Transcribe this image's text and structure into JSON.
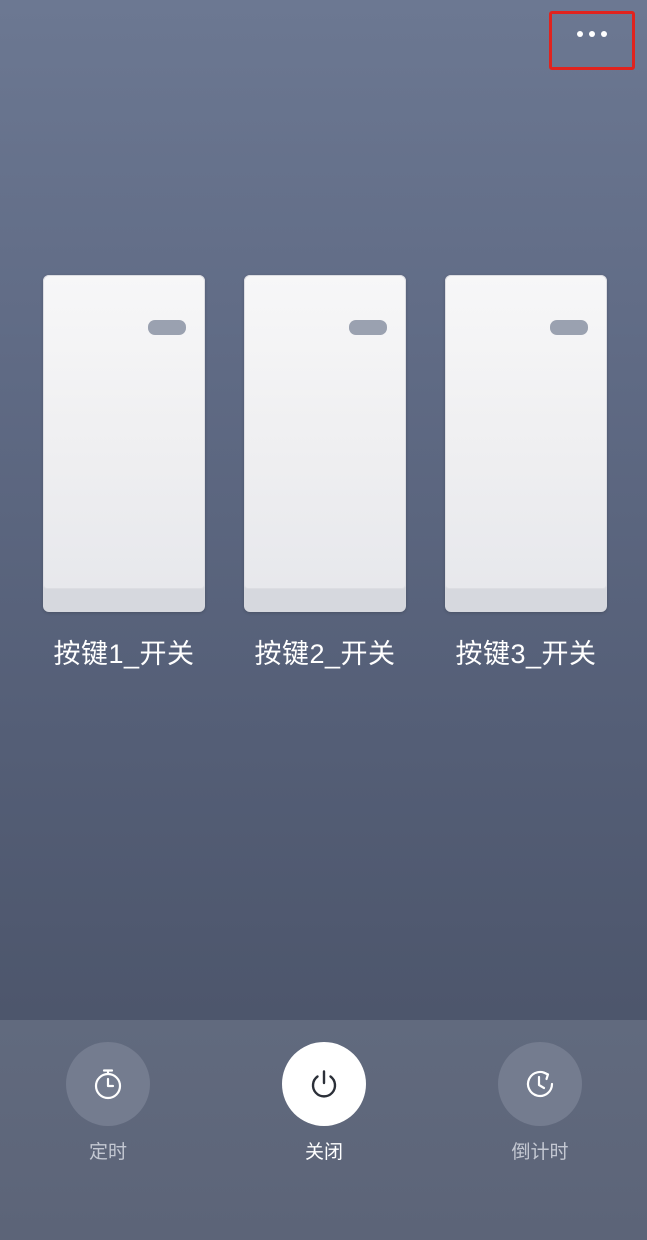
{
  "header": {
    "more_icon": "more-icon"
  },
  "switches": [
    {
      "label": "按键1_开关"
    },
    {
      "label": "按键2_开关"
    },
    {
      "label": "按键3_开关"
    }
  ],
  "actions": {
    "timer": {
      "label": "定时",
      "icon": "stopwatch-icon"
    },
    "power": {
      "label": "关闭",
      "icon": "power-icon"
    },
    "countdown": {
      "label": "倒计时",
      "icon": "countdown-clock-icon"
    }
  },
  "colors": {
    "highlight_border": "#e0231e",
    "indicator": "#9aa1b0"
  }
}
